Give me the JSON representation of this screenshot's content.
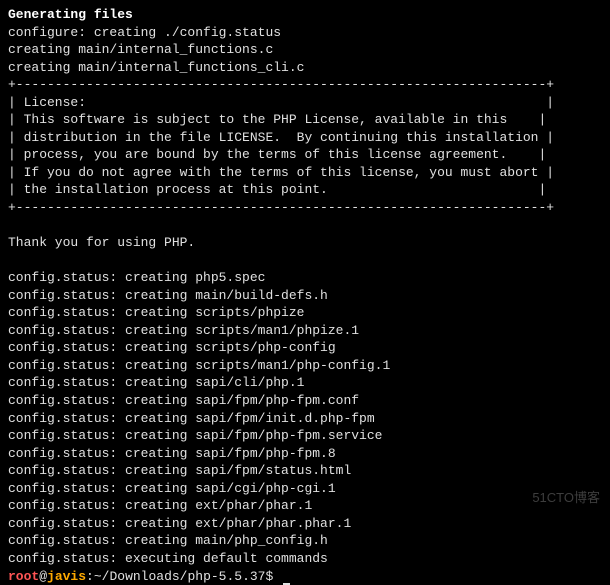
{
  "header": {
    "title": "Generating files",
    "lines": [
      "configure: creating ./config.status",
      "creating main/internal_functions.c",
      "creating main/internal_functions_cli.c"
    ]
  },
  "license_box": {
    "border_top": "+--------------------------------------------------------------------+",
    "lines": [
      "| License:                                                           |",
      "| This software is subject to the PHP License, available in this    |",
      "| distribution in the file LICENSE.  By continuing this installation |",
      "| process, you are bound by the terms of this license agreement.    |",
      "| If you do not agree with the terms of this license, you must abort |",
      "| the installation process at this point.                           |"
    ],
    "border_bottom": "+--------------------------------------------------------------------+"
  },
  "thanks": "Thank you for using PHP.",
  "status_lines": [
    "config.status: creating php5.spec",
    "config.status: creating main/build-defs.h",
    "config.status: creating scripts/phpize",
    "config.status: creating scripts/man1/phpize.1",
    "config.status: creating scripts/php-config",
    "config.status: creating scripts/man1/php-config.1",
    "config.status: creating sapi/cli/php.1",
    "config.status: creating sapi/fpm/php-fpm.conf",
    "config.status: creating sapi/fpm/init.d.php-fpm",
    "config.status: creating sapi/fpm/php-fpm.service",
    "config.status: creating sapi/fpm/php-fpm.8",
    "config.status: creating sapi/fpm/status.html",
    "config.status: creating sapi/cgi/php-cgi.1",
    "config.status: creating ext/phar/phar.1",
    "config.status: creating ext/phar/phar.phar.1",
    "config.status: creating main/php_config.h",
    "config.status: executing default commands"
  ],
  "prompt": {
    "user": "root",
    "at": "@",
    "host": "javis",
    "sep": ":",
    "path": "~/Downloads/php-5.5.37",
    "end": "$ "
  },
  "watermark": "51CTO博客"
}
